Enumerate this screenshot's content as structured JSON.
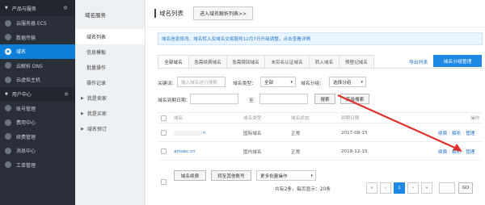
{
  "sidebar": {
    "top_label": "产品与服务",
    "items": [
      {
        "label": "云服务器 ECS",
        "icon": "server-icon"
      },
      {
        "label": "数据传输",
        "icon": "transfer-icon"
      },
      {
        "label": "域名",
        "icon": "globe-icon",
        "active": true
      },
      {
        "label": "云解析 DNS",
        "icon": "dns-icon"
      },
      {
        "label": "云虚拟主机",
        "icon": "host-icon"
      }
    ],
    "group2_label": "用户中心",
    "items2": [
      {
        "label": "账号管理",
        "icon": "user-icon"
      },
      {
        "label": "费用中心",
        "icon": "money-icon"
      },
      {
        "label": "续费管理",
        "icon": "renew-icon"
      },
      {
        "label": "消息中心",
        "icon": "message-icon"
      },
      {
        "label": "工单管理",
        "icon": "ticket-icon"
      }
    ],
    "accent": "#0e7fd8"
  },
  "subnav": {
    "header": "域名服务",
    "items": [
      "域名列表",
      "信息模板",
      "批量操作",
      "操作记录",
      "我是卖家",
      "我是买家",
      "域名预订"
    ]
  },
  "topbar": {
    "title": "域名列表",
    "button": "进入域名解析列表>>"
  },
  "notice": "域名信息修改、域名转入及域名交易服务12月7日升级调整，点击查看详情",
  "tabs": [
    "全部域名",
    "急需续费域名",
    "急需赎回域名",
    "未实名认证域名",
    "转入域名",
    "预登记域名"
  ],
  "export_link": "导出列表",
  "group_manage_btn": "域名分组管理",
  "filters": {
    "keyword_label": "关键词：",
    "keyword_placeholder": "输入域名进行搜索",
    "type_label": "域名类型：",
    "type_value": "全部",
    "group_label": "域名分组：",
    "group_value": "选择分组",
    "expire_label": "域名到期日期：",
    "to_label": "至",
    "search_btn": "搜索",
    "advanced_btn": "高级搜索"
  },
  "table": {
    "headers": [
      "域名",
      "域名类型",
      "域名状态",
      "到期日期",
      "操作"
    ],
    "rows": [
      {
        "domain": "n",
        "type": "国际域名",
        "status": "正常",
        "expire": "2017-08-15",
        "actions": [
          "续费",
          "解析",
          "管理"
        ]
      },
      {
        "domain": "amsec.cn",
        "type": "国内域名",
        "status": "正常",
        "expire": "2018-12-15",
        "actions": [
          "续费",
          "解析",
          "管理"
        ]
      }
    ]
  },
  "bottom": {
    "renew_btn": "域名续费",
    "transfer_btn": "转至其他账号",
    "more_btn": "更多批量操作",
    "summary": "共有2条，每页显示：20条",
    "pages": [
      "«",
      "‹",
      "1",
      "›",
      "»"
    ],
    "go_btn": "GO"
  },
  "colors": {
    "primary": "#1e88e5",
    "arrow": "#e0302a"
  }
}
